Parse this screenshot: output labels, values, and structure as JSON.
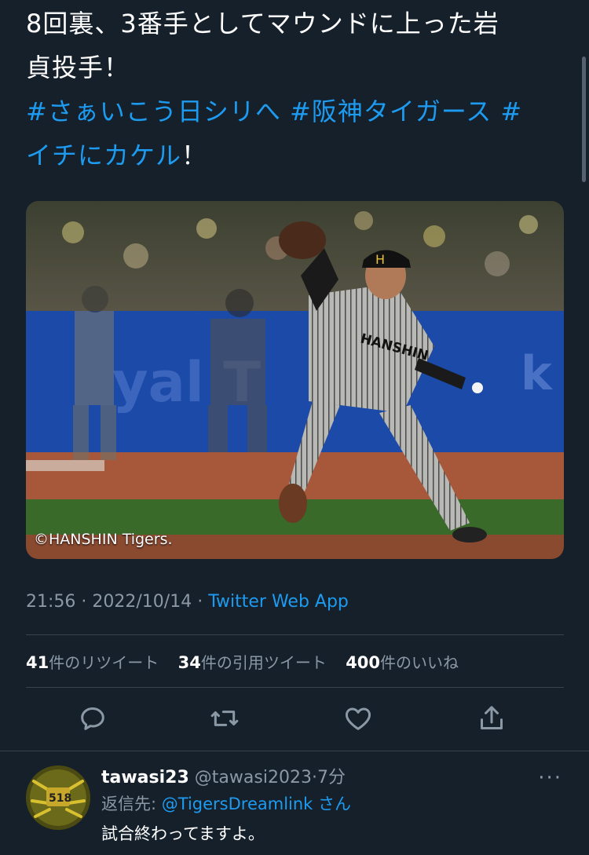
{
  "tweet": {
    "text_line1": "8回裏、3番手としてマウンドに上った岩",
    "text_line2": "貞投手！",
    "hashtag1": "#さぁいこう日シリへ",
    "hashtag2": "#阪神タイガース",
    "hashtag3_start": "#",
    "hashtag3_end": "イチにカケル",
    "trailing": "！",
    "image_credit": "©HANSHIN Tigers.",
    "time": "21:56",
    "sep": "·",
    "date": "2022/10/14",
    "app": "Twitter Web App"
  },
  "stats": {
    "retweets_count": "41",
    "retweets_label": "件のリツイート",
    "quotes_count": "34",
    "quotes_label": "件の引用ツイート",
    "likes_count": "400",
    "likes_label": "件のいいね"
  },
  "actions": {
    "reply_icon": "reply-icon",
    "retweet_icon": "retweet-icon",
    "like_icon": "heart-icon",
    "share_icon": "share-icon"
  },
  "reply": {
    "name": "tawasi23",
    "handle": "@tawasi2023",
    "sep": "·",
    "time": "7分",
    "reply_to_label": "返信先:",
    "reply_to_handle": "@TigersDreamlink",
    "reply_to_suffix": "さん",
    "text": "試合終わってますよ。",
    "more": "···"
  },
  "colors": {
    "background": "#15202b",
    "link": "#1d9bf0",
    "muted": "#8b98a5",
    "divider": "#38444d"
  }
}
